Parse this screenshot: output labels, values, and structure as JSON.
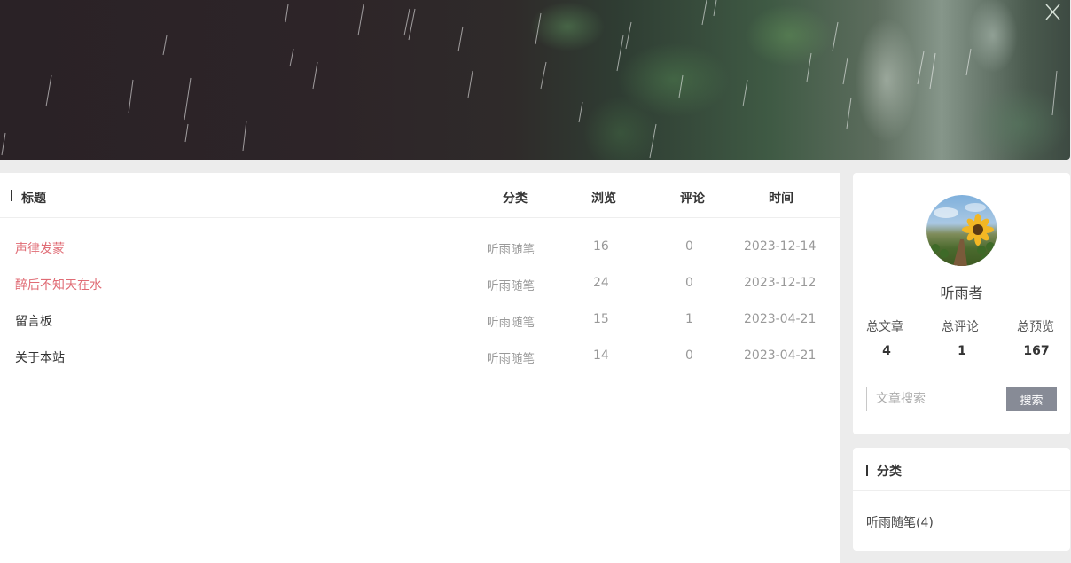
{
  "table": {
    "headers": {
      "title": "标题",
      "category": "分类",
      "views": "浏览",
      "comments": "评论",
      "time": "时间"
    },
    "rows": [
      {
        "title": "声律发蒙",
        "category": "听雨随笔",
        "views": "16",
        "comments": "0",
        "date": "2023-12-14",
        "highlight": true
      },
      {
        "title": "醉后不知天在水",
        "category": "听雨随笔",
        "views": "24",
        "comments": "0",
        "date": "2023-12-12",
        "highlight": true
      },
      {
        "title": "留言板",
        "category": "听雨随笔",
        "views": "15",
        "comments": "1",
        "date": "2023-04-21",
        "highlight": false
      },
      {
        "title": "关于本站",
        "category": "听雨随笔",
        "views": "14",
        "comments": "0",
        "date": "2023-04-21",
        "highlight": false
      }
    ]
  },
  "profile": {
    "name": "听雨者",
    "stats": [
      {
        "label": "总文章",
        "value": "4"
      },
      {
        "label": "总评论",
        "value": "1"
      },
      {
        "label": "总预览",
        "value": "167"
      }
    ]
  },
  "search": {
    "placeholder": "文章搜索",
    "value": "",
    "button_label": "搜索"
  },
  "categories": {
    "title": "分类",
    "items": [
      {
        "label": "听雨随笔(4)"
      }
    ]
  },
  "colors": {
    "highlight_title": "#e06c75",
    "search_button": "#878b96"
  }
}
